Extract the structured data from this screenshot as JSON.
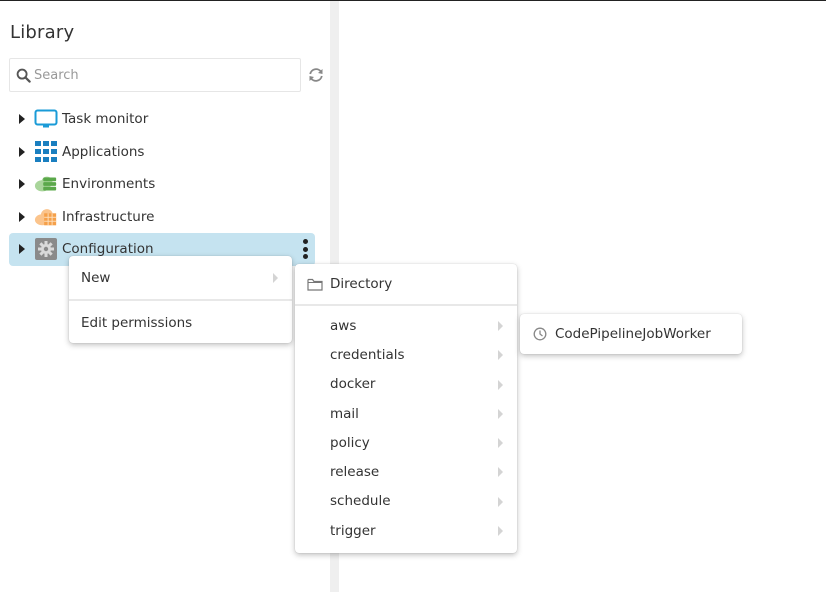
{
  "library": {
    "title": "Library",
    "search": {
      "placeholder": "Search",
      "value": ""
    },
    "tree": [
      {
        "label": "Task monitor",
        "icon": "monitor-icon",
        "selected": false
      },
      {
        "label": "Applications",
        "icon": "grid-icon",
        "selected": false
      },
      {
        "label": "Environments",
        "icon": "environments-cloud-icon",
        "selected": false
      },
      {
        "label": "Infrastructure",
        "icon": "infrastructure-cloud-icon",
        "selected": false
      },
      {
        "label": "Configuration",
        "icon": "gear-icon",
        "selected": true
      }
    ]
  },
  "context_menu": {
    "items": [
      {
        "label": "New",
        "has_submenu": true
      },
      {
        "label": "Edit permissions",
        "has_submenu": false
      }
    ]
  },
  "new_menu": {
    "directory_label": "Directory",
    "types": [
      "aws",
      "credentials",
      "docker",
      "mail",
      "policy",
      "release",
      "schedule",
      "trigger"
    ]
  },
  "aws_submenu": {
    "items": [
      {
        "label": "CodePipelineJobWorker",
        "icon": "clock-icon"
      }
    ]
  },
  "colors": {
    "selected_bg": "#c5e3f0",
    "monitor": "#1a9bd7",
    "applications": "#1a7fc0",
    "environments": "#6cb35a",
    "infrastructure": "#f5a04a",
    "configuration": "#8a8a8a"
  }
}
